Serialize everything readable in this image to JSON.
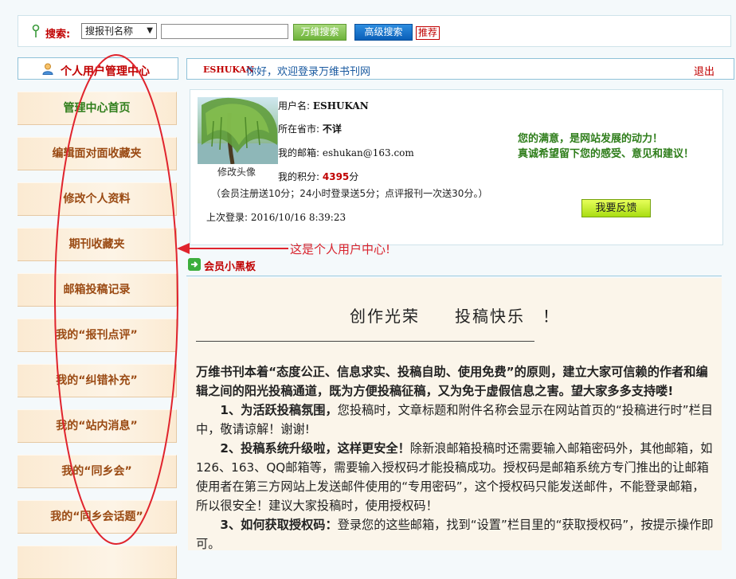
{
  "search": {
    "label": "搜索:",
    "select_value": "搜报刊名称",
    "input_value": "",
    "btn_wanwei": "万维搜索",
    "btn_advanced": "高级搜索",
    "btn_recommend": "推荐"
  },
  "sidebar": {
    "title": "个人用户管理中心",
    "items": [
      {
        "label": "管理中心首页"
      },
      {
        "label": "编辑面对面收藏夹"
      },
      {
        "label": "修改个人资料"
      },
      {
        "label": "期刊收藏夹"
      },
      {
        "label": "邮箱投稿记录"
      },
      {
        "label": "我的“报刊点评”"
      },
      {
        "label": "我的“纠错补充”"
      },
      {
        "label": "我的“站内消息”"
      },
      {
        "label": "我的“同乡会”"
      },
      {
        "label": "我的“同乡会话题”"
      }
    ]
  },
  "welcome": {
    "username": "ESHUKAN",
    "text": "你好，欢迎登录万维书刊网",
    "logout": "退出"
  },
  "profile": {
    "edit_avatar": "修改头像",
    "username_label": "用户名:",
    "username": "ESHUKAN",
    "province_label": "所在省市:",
    "province": "不详",
    "email_label": "我的邮箱:",
    "email": "eshukan@163.com",
    "points_label": "我的积分:",
    "points": "4395",
    "points_unit": "分",
    "rules": "（会员注册送10分；24小时登录送5分；点评报刊一次送30分。）",
    "last_login_label": "上次登录:",
    "last_login": "2016/10/16 8:39:23",
    "motto_line1": "您的满意，是网站发展的动力！",
    "motto_line2": "真诚希望留下您的感受、意见和建议！",
    "feedback_button": "我要反馈"
  },
  "board": {
    "title": "会员小黑板"
  },
  "article": {
    "heading": "创作光荣　　投稿快乐　！",
    "para1": "万维书刊本着“态度公正、信息求实、投稿自助、使用免费”的原则，建立大家可信赖的作者和编辑之间的阳光投稿通道，既为方便投稿征稿，又为免于虚假信息之害。望大家多多支持喽!",
    "item1_bold": "1、为活跃投稿氛围，",
    "item1_text": "您投稿时，文章标题和附件名称会显示在网站首页的“投稿进行时”栏目中，敬请谅解！谢谢!",
    "item2_bold": "2、投稿系统升级啦，这样更安全！",
    "item2_text": "除新浪邮箱投稿时还需要输入邮箱密码外，其他邮箱，如126、163、QQ邮箱等，需要输入授权码才能投稿成功。授权码是邮箱系统方专门推出的让邮箱使用者在第三方网站上发送邮件使用的“专用密码”，这个授权码只能发送邮件，不能登录邮箱，所以很安全！建议大家投稿时，使用授权码！",
    "item3_bold": "3、如何获取授权码：",
    "item3_text": "登录您的这些邮箱，找到“设置”栏目里的“获取授权码”，按提示操作即可。"
  },
  "annotation": {
    "text": "这是个人用户中心!",
    "color": "#d9232d"
  },
  "colors": {
    "accent_red": "#c00000",
    "link_blue": "#1a5aa0",
    "green": "#2e7d1a",
    "sidebar_text": "#9a4a13"
  }
}
